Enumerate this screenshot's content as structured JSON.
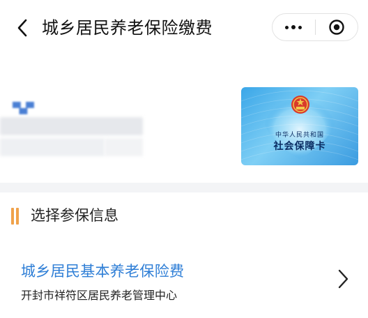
{
  "header": {
    "title": "城乡居民养老保险缴费",
    "back_icon": "chevron-left-icon",
    "more_icon": "more-dots-icon",
    "close_icon": "record-target-icon"
  },
  "card": {
    "line1": "中华人民共和国",
    "line2": "社会保障卡",
    "emblem_icon": "national-emblem-icon",
    "colors": {
      "card_blue": "#3aa6e8",
      "text_navy": "#0b2d63"
    }
  },
  "section": {
    "title": "选择参保信息",
    "accent_color": "#f0a24a"
  },
  "insurance": {
    "title": "城乡居民基本养老保险费",
    "subtitle": "开封市祥符区居民养老管理中心",
    "title_color": "#2e7ed6",
    "arrow_icon": "chevron-right-icon"
  }
}
